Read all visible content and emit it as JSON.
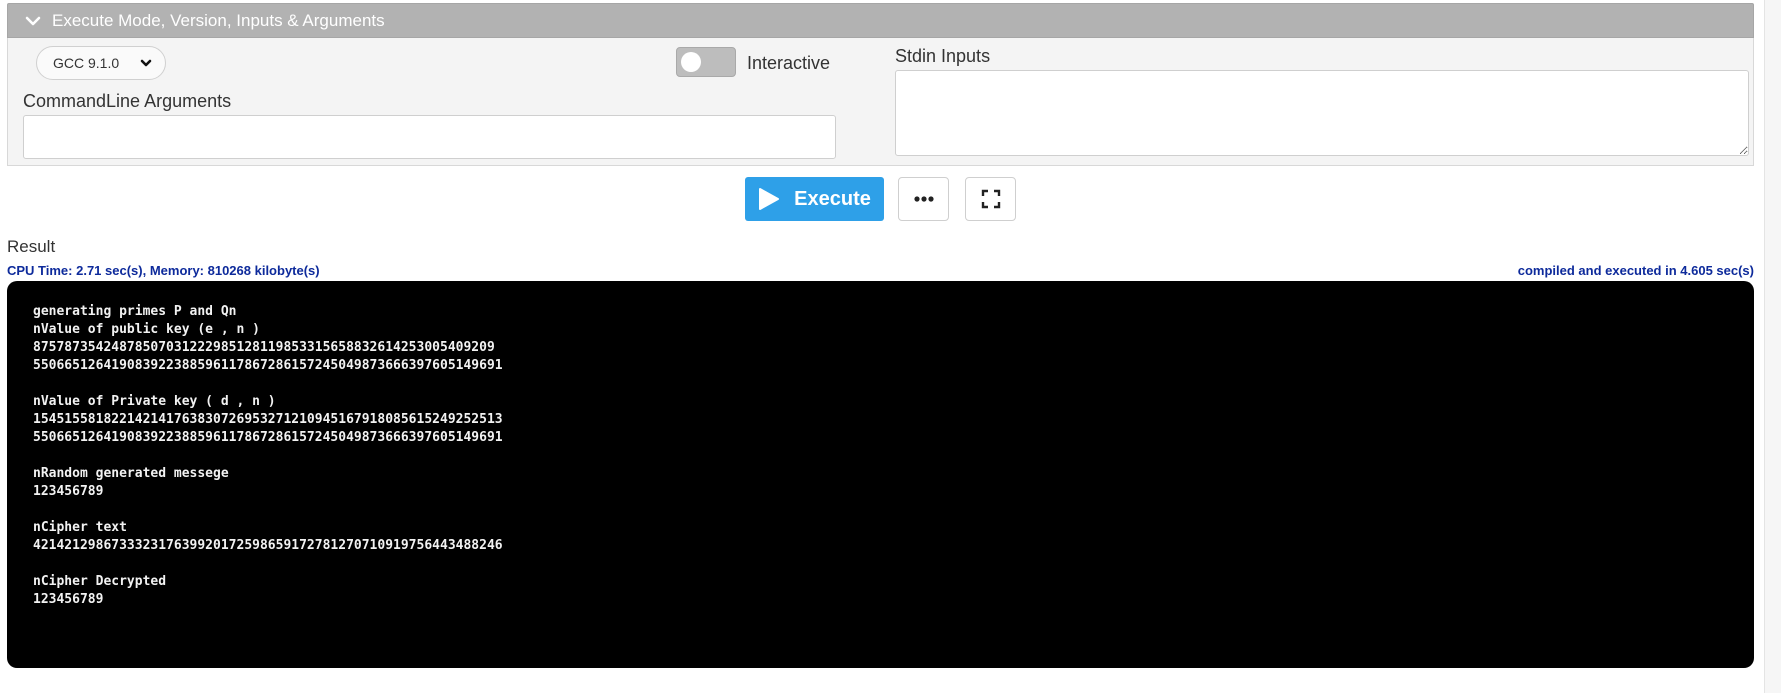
{
  "panel": {
    "title": "Execute Mode, Version, Inputs & Arguments"
  },
  "version": {
    "selected": "GCC 9.1.0"
  },
  "interactive": {
    "label": "Interactive",
    "enabled": false
  },
  "cmdline": {
    "label": "CommandLine Arguments",
    "value": ""
  },
  "stdin": {
    "label": "Stdin Inputs",
    "value": ""
  },
  "actions": {
    "execute_label": "Execute"
  },
  "result": {
    "label": "Result",
    "stats": "CPU Time: 2.71 sec(s), Memory: 810268 kilobyte(s)",
    "compile_info": "compiled and executed in 4.605 sec(s)",
    "output_lines": [
      "generating primes P and Qn",
      "nValue of public key (e , n )",
      "875787354248785070312229851281198533156588326142530054092​09",
      "550665126419083922388596117867286157245049873666397605149691",
      "",
      "nValue of Private key ( d , n )",
      "154515581822142141763830726953271210945167918085615249252513",
      "550665126419083922388596117867286157245049873666397605149691",
      "",
      "nRandom generated messege",
      "123456789",
      "",
      "nCipher text",
      "421421298673332317639920172598659172781270710919756443488246",
      "",
      "nCipher Decrypted",
      "123456789"
    ]
  },
  "colors": {
    "execute_button": "#2ea0e8",
    "panel_header": "#b2b2b2",
    "stats_text": "#0d2a9b",
    "output_bg": "#000000"
  }
}
